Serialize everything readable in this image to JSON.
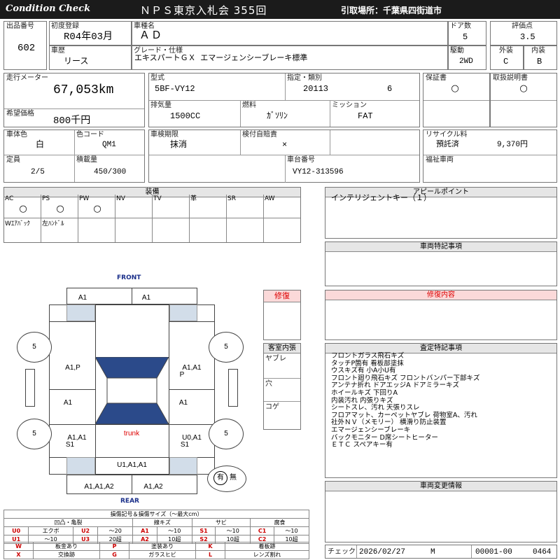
{
  "header": {
    "left": "Condition  Check",
    "center": "ＮＰＳ東京入札会  355回",
    "right": "引取場所：千葉県四街道市"
  },
  "row1": {
    "lot_label": "出品番号",
    "lot": "602",
    "reg_label": "初度登録",
    "reg": "R04年03月",
    "name_label": "車種名",
    "name": "ＡＤ",
    "door_label": "ドア数",
    "door": "5",
    "score_label": "評価点",
    "score": "3.5",
    "history_label": "車歴",
    "history": "リース",
    "grade_label": "グレード・仕様",
    "grade": "エキスパートＧＸ  エマージェンシーブレーキ標準",
    "drive_label": "駆動",
    "drive": "2WD",
    "ext_label": "外装",
    "ext": "C",
    "int_label": "内装",
    "int": "B"
  },
  "row2": {
    "odo_label": "走行メーター",
    "odo": "67,053km",
    "model_label": "型式",
    "model": "5BF-VY12",
    "desig_label": "指定・類別",
    "desig": "20113",
    "class": "6",
    "warranty_label": "保証書",
    "warranty": "○",
    "manual_label": "取扱説明書",
    "manual": "○",
    "price_label": "希望価格",
    "price": "800千円",
    "disp_label": "排気量",
    "disp": "1500CC",
    "fuel_label": "燃料",
    "fuel": "ｶﾞｿﾘﾝ",
    "mission_label": "ミッション",
    "mission": "FAT"
  },
  "row3": {
    "color_label": "車体色",
    "color": "白",
    "ccode_label": "色コード",
    "ccode": "QM1",
    "inspect_label": "車検期限",
    "inspect": "抹消",
    "liability_label": "検付自賠責",
    "liability": "×",
    "recycle_label": "リサイクル料",
    "recycle_status": "預託済",
    "recycle_fee": "9,370円"
  },
  "row4": {
    "cap_label": "定員",
    "cap": "2/5",
    "load_label": "積載量",
    "load": "450/300",
    "chassis_label": "車台番号",
    "chassis": "VY12-313596",
    "welfare_label": "福祉車両"
  },
  "equip": {
    "title": "装備",
    "row1": [
      {
        "k": "AC",
        "v": "○"
      },
      {
        "k": "PS",
        "v": "○"
      },
      {
        "k": "PW",
        "v": "○"
      },
      {
        "k": "NV",
        "v": ""
      },
      {
        "k": "TV",
        "v": ""
      },
      {
        "k": "革",
        "v": ""
      },
      {
        "k": "SR",
        "v": ""
      },
      {
        "k": "AW",
        "v": ""
      }
    ],
    "row2": [
      {
        "k": "Wｴｱﾊﾞｯｸ",
        "v": ""
      },
      {
        "k": "左ﾊﾝﾄﾞﾙ",
        "v": ""
      }
    ]
  },
  "diagram": {
    "front": "FRONT",
    "rear": "REAR",
    "trunk": "trunk",
    "marks": {
      "front_l": "A1",
      "front_r": "A1",
      "l_front_door": "A1,P",
      "r_front_door_1": "A1,A1",
      "r_front_door_2": "P",
      "l_rear_door": "A1",
      "r_rear_door": "A1",
      "l_quarter_1": "A1,A1",
      "l_quarter_2": "S1",
      "r_quarter_1": "U0,A1",
      "r_quarter_2": "S1",
      "rear_gate": "U1,A1,A1",
      "rear_bumper_l": "A1,A1,A2",
      "rear_bumper_r": "A1,A2",
      "tire_fl": "5",
      "tire_fr": "5",
      "tire_rl": "5",
      "tire_rr": "5"
    },
    "spare_on": "有",
    "spare_off": "無"
  },
  "repair": {
    "title": "修復"
  },
  "cabin": {
    "title": "客室内張",
    "items": [
      "ヤブレ",
      "穴",
      "コゲ"
    ]
  },
  "appeal": {
    "title": "アピールポイント",
    "text": "インテリジェントキー（１）"
  },
  "special": {
    "title": "車両特記事項"
  },
  "repair_detail": {
    "title": "修復内容"
  },
  "inspection": {
    "title": "査定特記事項",
    "lines": [
      "フロントガラス飛石キズ",
      "タッチP箇有  看板部塗抹",
      "ウスキズ有  小A小U有",
      "フロント廻り飛石キズ  フロントバンパー下部キズ",
      "アンテナ折れ  ドアエッジA  ドアミラーキズ",
      "ホイールキズ  下回りA",
      "内装汚れ  内張りキズ",
      "シートスレ、汚れ  天張りスレ",
      "フロアマット、カーペットヤブレ  荷物室A、汚れ",
      "社外ＮＶ（メモリー）  横滑り防止装置",
      "エマージェンシーブレーキ",
      "バックモニター  D席シートヒーター",
      "ＥＴＣ  スペアキー有"
    ]
  },
  "change": {
    "title": "車両変更情報"
  },
  "legend": {
    "title": "損傷記号＆損傷サイズ（～最大cm）",
    "groups": [
      "凹凸・亀裂",
      "線キズ",
      "サビ",
      "腐食"
    ],
    "row1": [
      [
        "U0",
        "エクボ"
      ],
      [
        "U2",
        "～20"
      ],
      [
        "A1",
        "～10"
      ],
      [
        "S1",
        "～10"
      ],
      [
        "C1",
        "～10"
      ]
    ],
    "row2": [
      [
        "U1",
        "～10"
      ],
      [
        "U3",
        "20超"
      ],
      [
        "A2",
        "10超"
      ],
      [
        "S2",
        "10超"
      ],
      [
        "C2",
        "10超"
      ]
    ],
    "row3": [
      [
        "W",
        "板金あり"
      ],
      [
        "P",
        "塗装あり"
      ],
      [
        "K",
        "着板跡"
      ]
    ],
    "row4": [
      [
        "X",
        "交換跡"
      ],
      [
        "G",
        "ガラスヒビ"
      ],
      [
        "L",
        "レンズ割れ"
      ]
    ]
  },
  "check": {
    "label": "チェック",
    "date": "2026/02/27",
    "mark": "M",
    "num1": "00001-00",
    "num2": "0464"
  }
}
